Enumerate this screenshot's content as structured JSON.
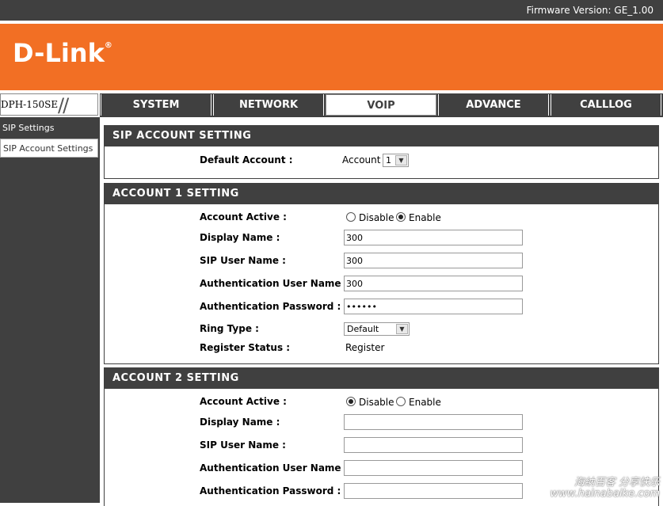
{
  "topbar": {
    "firmware": "Firmware Version: GE_1.00"
  },
  "brand": {
    "logo": "D-Link",
    "trademark": "®"
  },
  "model": "DPH-150SE",
  "tabs": [
    "SYSTEM",
    "NETWORK",
    "VOIP",
    "ADVANCE",
    "CALLLOG"
  ],
  "active_tab": "VOIP",
  "sidebar": {
    "items": [
      {
        "label": "SIP Settings"
      },
      {
        "label": "SIP Account Settings"
      }
    ]
  },
  "sip_account": {
    "title": "SIP ACCOUNT SETTING",
    "default_label": "Default Account :",
    "account_word": "Account",
    "selected_account": "1"
  },
  "account1": {
    "title": "ACCOUNT 1 SETTING",
    "active_label": "Account Active :",
    "disable_label": "Disable",
    "enable_label": "Enable",
    "active_value": "Enable",
    "display_label": "Display Name :",
    "display_value": "300",
    "sip_user_label": "SIP User Name :",
    "sip_user_value": "300",
    "auth_user_label": "Authentication User Name :",
    "auth_user_value": "300",
    "auth_pass_label": "Authentication Password :",
    "auth_pass_value": "••••••",
    "ring_label": "Ring Type :",
    "ring_value": "Default",
    "register_label": "Register Status :",
    "register_value": "Register"
  },
  "account2": {
    "title": "ACCOUNT 2 SETTING",
    "active_label": "Account Active :",
    "disable_label": "Disable",
    "enable_label": "Enable",
    "active_value": "Disable",
    "display_label": "Display Name :",
    "display_value": "",
    "sip_user_label": "SIP User Name :",
    "sip_user_value": "",
    "auth_user_label": "Authentication User Name :",
    "auth_user_value": "",
    "auth_pass_label": "Authentication Password :",
    "auth_pass_value": ""
  },
  "watermark": {
    "line1": "海纳百客 分享快乐",
    "line2": "www.hainabaike.com"
  },
  "colors": {
    "accent": "#f26f24",
    "dark": "#404040"
  }
}
